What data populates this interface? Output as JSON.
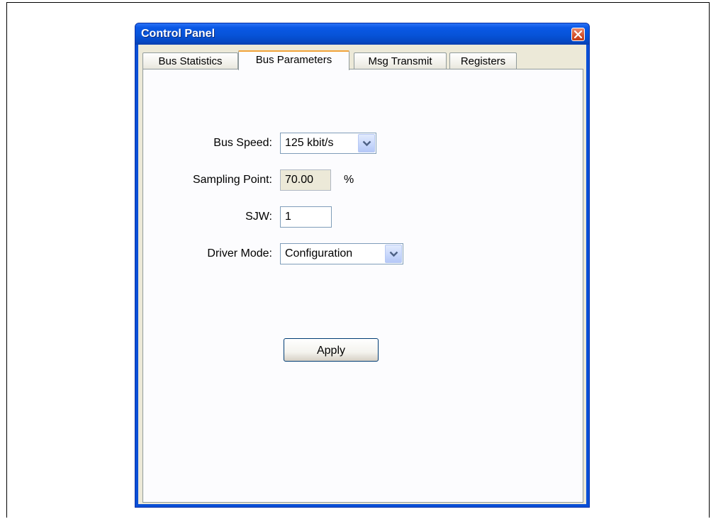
{
  "window": {
    "title": "Control Panel"
  },
  "tabs": [
    {
      "label": "Bus Statistics",
      "active": false
    },
    {
      "label": "Bus Parameters",
      "active": true
    },
    {
      "label": "Msg Transmit",
      "active": false
    },
    {
      "label": "Registers",
      "active": false
    }
  ],
  "form": {
    "bus_speed": {
      "label": "Bus Speed:",
      "value": "125 kbit/s"
    },
    "sampling_point": {
      "label": "Sampling Point:",
      "value": "70.00",
      "unit": "%"
    },
    "sjw": {
      "label": "SJW:",
      "value": "1"
    },
    "driver_mode": {
      "label": "Driver Mode:",
      "value": "Configuration"
    },
    "apply_label": "Apply"
  },
  "colors": {
    "titlebar": "#0753d8",
    "tab_active_accent": "#f1a33b",
    "client_bg": "#ece9d8",
    "close_button": "#d4502b"
  },
  "icons": {
    "close": "close-icon",
    "dropdown": "chevron-down-icon"
  }
}
